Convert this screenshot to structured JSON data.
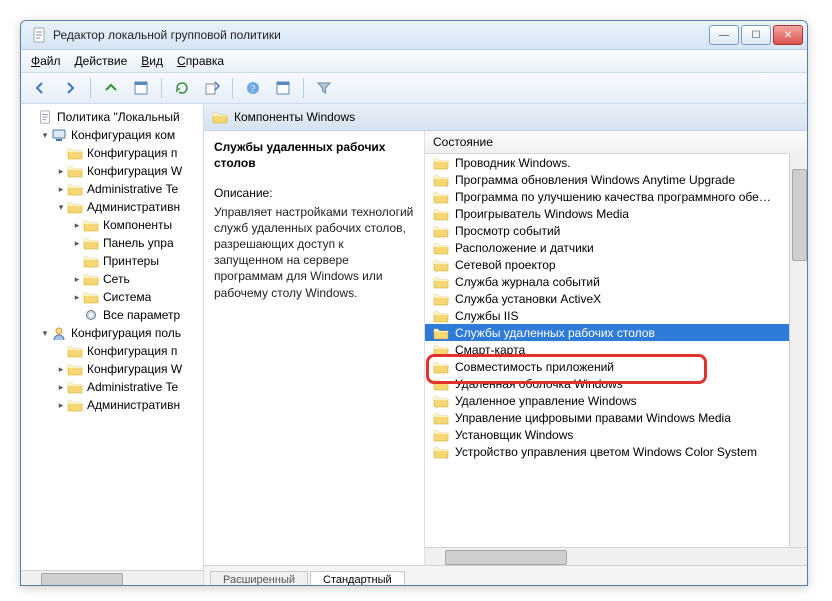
{
  "window": {
    "title": "Редактор локальной групповой политики"
  },
  "menubar": {
    "file": "Файл",
    "action": "Действие",
    "view": "Вид",
    "help": "Справка"
  },
  "tree": {
    "root": "Политика \"Локальный",
    "nodes": [
      {
        "label": "Конфигурация ком",
        "indent": 1,
        "caret": "▾",
        "icon": "computer"
      },
      {
        "label": "Конфигурация п",
        "indent": 2,
        "caret": "",
        "icon": "folder"
      },
      {
        "label": "Конфигурация W",
        "indent": 2,
        "caret": "▸",
        "icon": "folder"
      },
      {
        "label": "Administrative Te",
        "indent": 2,
        "caret": "▸",
        "icon": "folder"
      },
      {
        "label": "Административн",
        "indent": 2,
        "caret": "▾",
        "icon": "folder"
      },
      {
        "label": "Компоненты",
        "indent": 3,
        "caret": "▸",
        "icon": "folder"
      },
      {
        "label": "Панель упра",
        "indent": 3,
        "caret": "▸",
        "icon": "folder"
      },
      {
        "label": "Принтеры",
        "indent": 3,
        "caret": "",
        "icon": "folder"
      },
      {
        "label": "Сеть",
        "indent": 3,
        "caret": "▸",
        "icon": "folder"
      },
      {
        "label": "Система",
        "indent": 3,
        "caret": "▸",
        "icon": "folder"
      },
      {
        "label": "Все параметр",
        "indent": 3,
        "caret": "",
        "icon": "settings"
      },
      {
        "label": "Конфигурация поль",
        "indent": 1,
        "caret": "▾",
        "icon": "user"
      },
      {
        "label": "Конфигурация п",
        "indent": 2,
        "caret": "",
        "icon": "folder"
      },
      {
        "label": "Конфигурация W",
        "indent": 2,
        "caret": "▸",
        "icon": "folder"
      },
      {
        "label": "Administrative Te",
        "indent": 2,
        "caret": "▸",
        "icon": "folder"
      },
      {
        "label": "Административн",
        "indent": 2,
        "caret": "▸",
        "icon": "folder"
      }
    ]
  },
  "main": {
    "header": "Компоненты Windows",
    "desc_title": "Службы удаленных рабочих столов",
    "desc_label": "Описание:",
    "desc_text": "Управляет настройками технологий служб удаленных рабочих столов, разрешающих доступ к запущенном на сервере программам для Windows или рабочему столу Windows.",
    "column_state": "Состояние",
    "items": [
      {
        "label": "Проводник Windows.",
        "sel": false
      },
      {
        "label": "Программа обновления Windows Anytime Upgrade",
        "sel": false
      },
      {
        "label": "Программа по улучшению качества программного обе…",
        "sel": false
      },
      {
        "label": "Проигрыватель Windows Media",
        "sel": false
      },
      {
        "label": "Просмотр событий",
        "sel": false
      },
      {
        "label": "Расположение и датчики",
        "sel": false
      },
      {
        "label": "Сетевой проектор",
        "sel": false
      },
      {
        "label": "Служба журнала событий",
        "sel": false
      },
      {
        "label": "Служба установки ActiveX",
        "sel": false
      },
      {
        "label": "Службы IIS",
        "sel": false
      },
      {
        "label": "Службы удаленных рабочих столов",
        "sel": true
      },
      {
        "label": "Смарт-карта",
        "sel": false
      },
      {
        "label": "Совместимость приложений",
        "sel": false
      },
      {
        "label": "Удаленная оболочка Windows",
        "sel": false
      },
      {
        "label": "Удаленное управление Windows",
        "sel": false
      },
      {
        "label": "Управление цифровыми правами Windows Media",
        "sel": false
      },
      {
        "label": "Установщик Windows",
        "sel": false
      },
      {
        "label": "Устройство управления цветом Windows Color System",
        "sel": false
      }
    ],
    "tabs": {
      "ext": "Расширенный",
      "std": "Стандартный"
    }
  }
}
